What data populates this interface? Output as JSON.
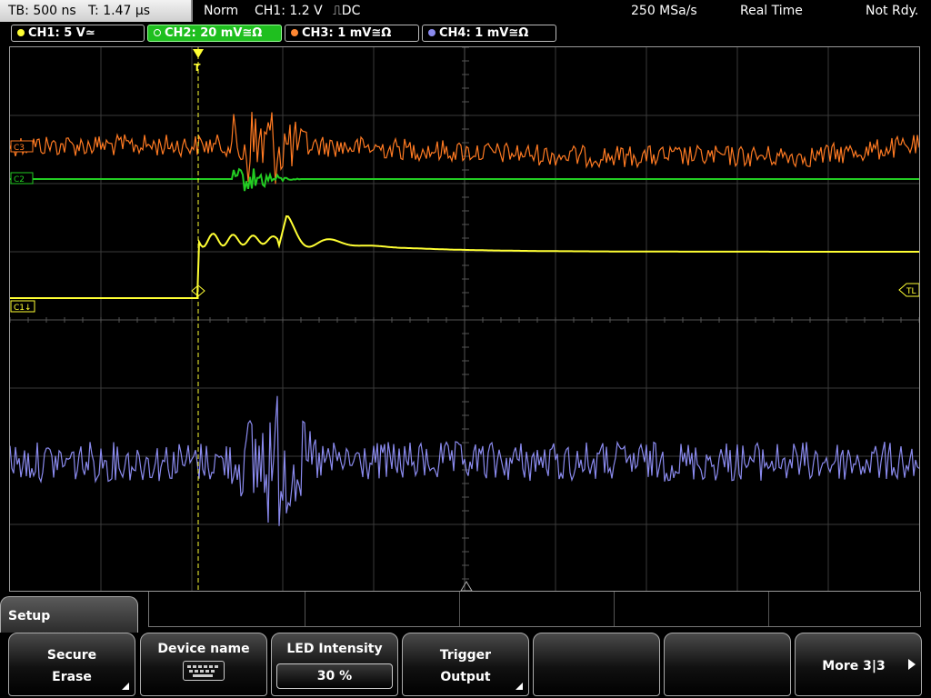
{
  "status_bar": {
    "timebase": "TB: 500 ns",
    "trigger_time": "T: 1.47 µs",
    "mode": "Norm",
    "trigger_source": "CH1: 1.2 V",
    "trigger_slope_coupling": "⎍DC",
    "sample_rate": "250 MSa/s",
    "acquisition": "Real Time",
    "state": "Not Rdy."
  },
  "channels": [
    {
      "label": "CH1: 5 V≃",
      "color": "#ffff33"
    },
    {
      "label": "CH2: 20 mV≅Ω",
      "color": "#33dd33"
    },
    {
      "label": "CH3: 1 mV≅Ω",
      "color": "#ff8833"
    },
    {
      "label": "CH4: 1 mV≅Ω",
      "color": "#8a8aee"
    }
  ],
  "markers": {
    "ch1": "C1↓",
    "ch2": "C2",
    "ch3": "C3",
    "trigger_level": "TL"
  },
  "menu": {
    "title": "Setup",
    "softkeys": [
      {
        "line1": "Secure",
        "line2": "Erase"
      },
      {
        "line1": "Device name"
      },
      {
        "line1": "LED Intensity",
        "value": "30 %"
      },
      {
        "line1": "Trigger",
        "line2": "Output"
      },
      {
        "line1": ""
      },
      {
        "line1": ""
      },
      {
        "line1": "More 3|3"
      }
    ]
  },
  "colors": {
    "ch1": "#ffff33",
    "ch2": "#22cc22",
    "ch3": "#ff7a22",
    "ch4": "#8a8aee",
    "grid": "#3a3a3a",
    "trigger": "#ffff33"
  }
}
